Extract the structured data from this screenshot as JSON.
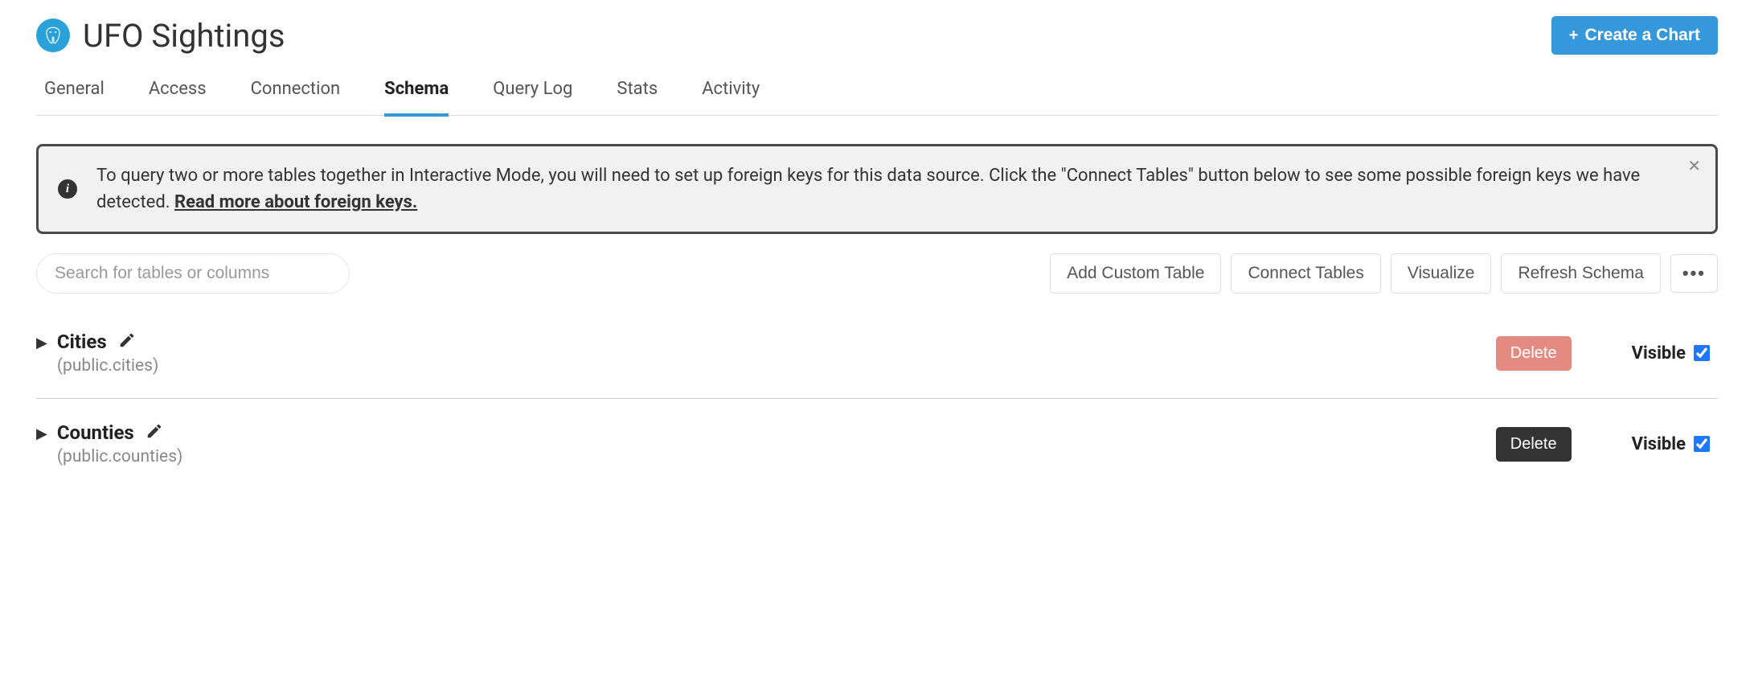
{
  "header": {
    "title": "UFO Sightings",
    "create_button": "Create a Chart"
  },
  "tabs": {
    "general": "General",
    "access": "Access",
    "connection": "Connection",
    "schema": "Schema",
    "query_log": "Query Log",
    "stats": "Stats",
    "activity": "Activity",
    "active": "schema"
  },
  "banner": {
    "text_part1": "To query two or more tables together in Interactive Mode, you will need to set up foreign keys for this data source. Click the \"Connect Tables\" button below to see some possible foreign keys we have detected. ",
    "link_text": "Read more about foreign keys."
  },
  "toolbar": {
    "search_placeholder": "Search for tables or columns",
    "add_custom": "Add Custom Table",
    "connect_tables": "Connect Tables",
    "visualize": "Visualize",
    "refresh_schema": "Refresh Schema"
  },
  "tables": [
    {
      "name": "Cities",
      "path": "(public.cities)",
      "delete_label": "Delete",
      "delete_style": "red",
      "visible_label": "Visible",
      "visible": true
    },
    {
      "name": "Counties",
      "path": "(public.counties)",
      "delete_label": "Delete",
      "delete_style": "dark",
      "visible_label": "Visible",
      "visible": true
    }
  ]
}
